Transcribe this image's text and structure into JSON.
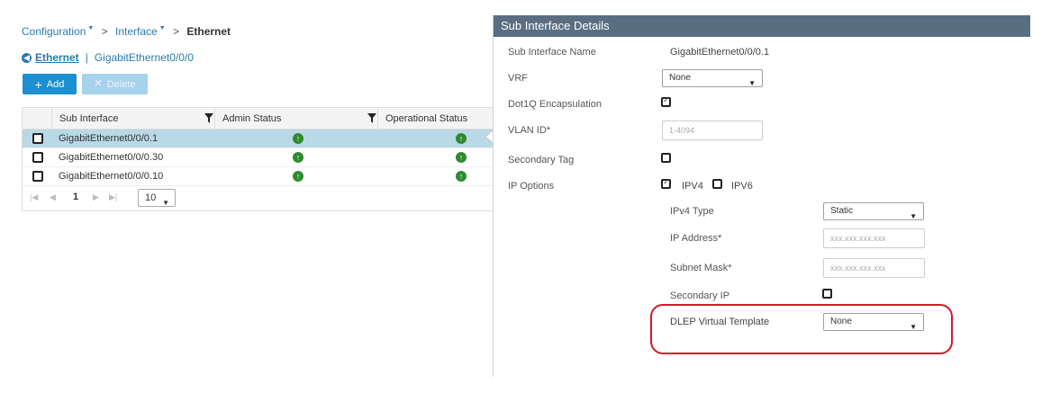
{
  "breadcrumb": {
    "item1": "Configuration",
    "item2": "Interface",
    "current": "Ethernet"
  },
  "back_link": {
    "section": "Ethernet",
    "item": "GigabitEthernet0/0/0"
  },
  "toolbar": {
    "add_label": "Add",
    "delete_label": "Delete"
  },
  "grid": {
    "columns": [
      "Sub Interface",
      "Admin Status",
      "Operational Status"
    ],
    "rows": [
      {
        "name": "GigabitEthernet0/0/0.1",
        "admin": "up",
        "oper": "up",
        "selected": true
      },
      {
        "name": "GigabitEthernet0/0/0.30",
        "admin": "up",
        "oper": "up",
        "selected": false
      },
      {
        "name": "GigabitEthernet0/0/0.10",
        "admin": "up",
        "oper": "up",
        "selected": false
      }
    ],
    "pager": {
      "page": "1",
      "page_size": "10"
    }
  },
  "details": {
    "title": "Sub Interface Details",
    "sub_interface_name_label": "Sub Interface Name",
    "sub_interface_name_value": "GigabitEthernet0/0/0.1",
    "vrf_label": "VRF",
    "vrf_value": "None",
    "dot1q_label": "Dot1Q Encapsulation",
    "dot1q_checked": true,
    "vlan_label": "VLAN ID*",
    "vlan_placeholder": "1-4094",
    "secondary_tag_label": "Secondary Tag",
    "secondary_tag_checked": false,
    "ip_options_label": "IP Options",
    "ipv4_label": "IPV4",
    "ipv4_checked": true,
    "ipv6_label": "IPV6",
    "ipv6_checked": false,
    "ipv4_type_label": "IPv4 Type",
    "ipv4_type_value": "Static",
    "ip_address_label": "IP Address*",
    "ip_address_placeholder": "xxx.xxx.xxx.xxx",
    "subnet_mask_label": "Subnet Mask*",
    "subnet_mask_placeholder": "xxx.xxx.xxx.xxx",
    "secondary_ip_label": "Secondary IP",
    "secondary_ip_checked": false,
    "dlep_label": "DLEP Virtual Template",
    "dlep_value": "None"
  },
  "colors": {
    "link": "#2a7ab0",
    "add_button": "#1b8fd0",
    "delete_button_disabled": "#a7d2ec",
    "panel_header": "#5a6e82",
    "selected_row": "#b9d9e6",
    "status_up": "#2e8b2e",
    "highlight": "#d11a2a"
  },
  "icons": {
    "back": "arrow-left-circle-icon",
    "add": "plus-icon",
    "delete": "close-icon",
    "filter": "filter-icon",
    "status": "arrow-up-circle-icon",
    "dropdown": "caret-down-icon"
  }
}
